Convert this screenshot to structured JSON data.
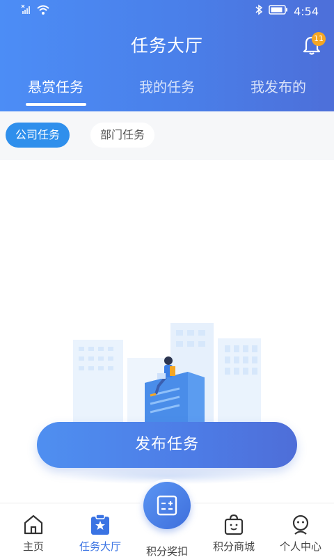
{
  "status_bar": {
    "time": "4:54",
    "icons": [
      "no-sim-icon",
      "wifi-icon",
      "bluetooth-icon",
      "battery-icon"
    ]
  },
  "header": {
    "title": "任务大厅",
    "notification_count": "11"
  },
  "tabs": [
    {
      "label": "悬赏任务",
      "active": true
    },
    {
      "label": "我的任务",
      "active": false
    },
    {
      "label": "我发布的",
      "active": false
    }
  ],
  "filters": [
    {
      "label": "公司任务",
      "active": true
    },
    {
      "label": "部门任务",
      "active": false
    }
  ],
  "publish_button": {
    "label": "发布任务"
  },
  "bottom_nav": [
    {
      "label": "主页",
      "icon": "home-icon",
      "active": false
    },
    {
      "label": "任务大厅",
      "icon": "task-hall-icon",
      "active": true
    },
    {
      "label": "积分奖扣",
      "icon": "calculator-icon",
      "active": false
    },
    {
      "label": "积分商城",
      "icon": "shopping-bag-icon",
      "active": false
    },
    {
      "label": "个人中心",
      "icon": "user-icon",
      "active": false
    }
  ],
  "colors": {
    "primary": "#4a7fe9",
    "chip_active": "#2f8fec",
    "badge": "#f5a623",
    "nav_active": "#3a73e3"
  }
}
